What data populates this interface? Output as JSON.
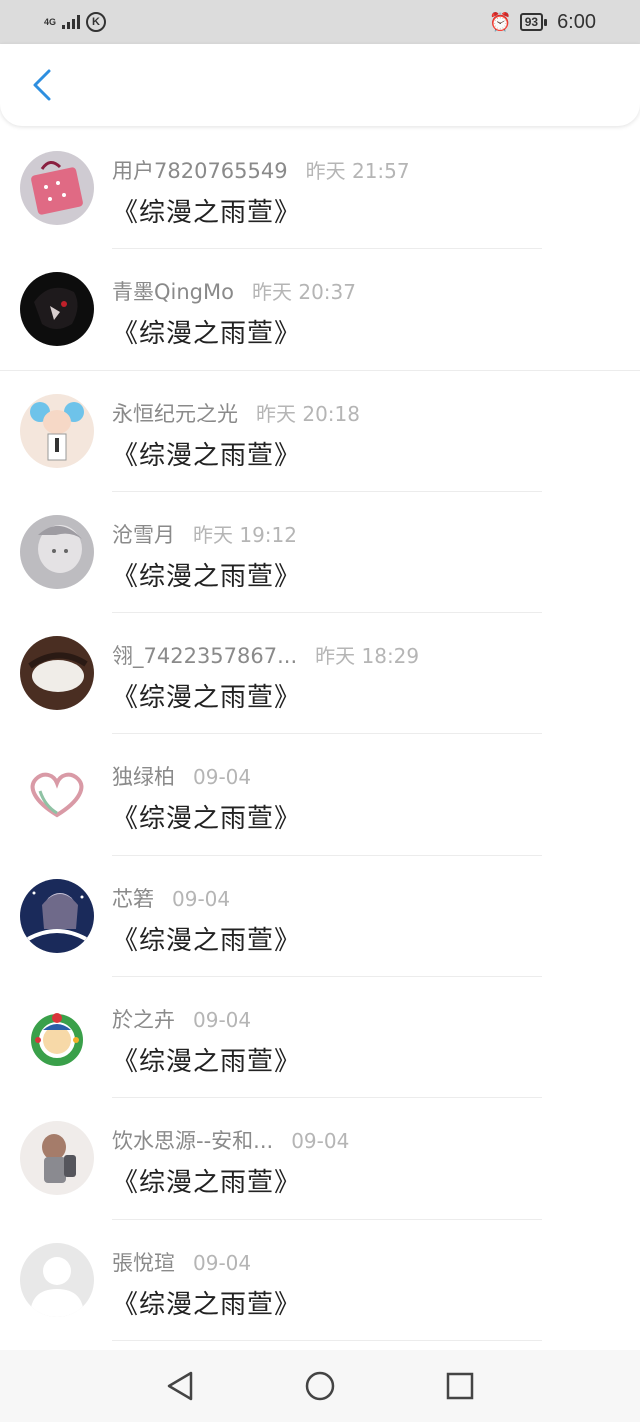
{
  "status": {
    "network": "4G",
    "battery": "93",
    "time": "6:00",
    "k_label": "K"
  },
  "comments": [
    {
      "user": "用户7820765549",
      "time": "昨天 21:57",
      "text": "《综漫之雨萱》"
    },
    {
      "user": "青墨QingMo",
      "time": "昨天 20:37",
      "text": "《综漫之雨萱》"
    },
    {
      "user": "永恒纪元之光",
      "time": "昨天 20:18",
      "text": "《综漫之雨萱》"
    },
    {
      "user": "沧雪月",
      "time": "昨天 19:12",
      "text": "《综漫之雨萱》"
    },
    {
      "user": "翎_7422357867...",
      "time": "昨天 18:29",
      "text": "《综漫之雨萱》"
    },
    {
      "user": "独绿柏",
      "time": "09-04",
      "text": "《综漫之雨萱》"
    },
    {
      "user": "芯箬",
      "time": "09-04",
      "text": "《综漫之雨萱》"
    },
    {
      "user": "於之卉",
      "time": "09-04",
      "text": "《综漫之雨萱》"
    },
    {
      "user": "饮水思源--安和...",
      "time": "09-04",
      "text": "《综漫之雨萱》"
    },
    {
      "user": "張悅瑄",
      "time": "09-04",
      "text": "《综漫之雨萱》"
    }
  ],
  "colors": {
    "accent": "#2e8fe0",
    "username": "#8a8a8a",
    "timestamp": "#b5b5b5"
  },
  "icons": {
    "back": "chevron-left-icon",
    "nav_back": "triangle-back-icon",
    "nav_home": "circle-home-icon",
    "nav_recent": "square-recent-icon"
  }
}
